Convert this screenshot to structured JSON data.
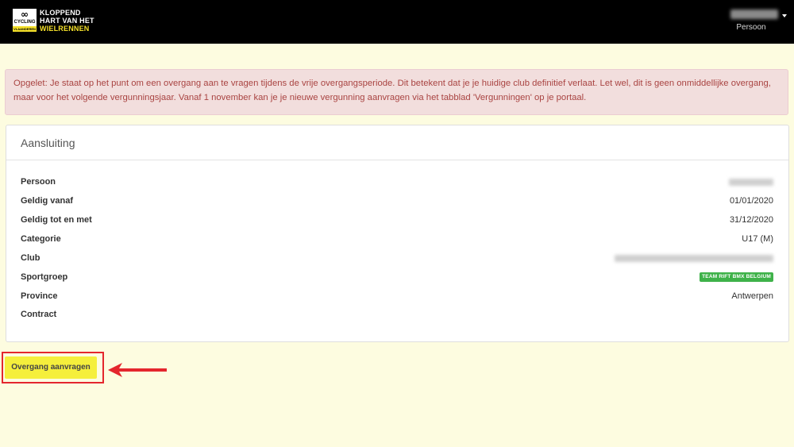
{
  "header": {
    "logo": {
      "icon": "infinity-icon",
      "mark": "∞",
      "cycling": "CYCLING",
      "vlaanderen": "VLAANDEREN",
      "line1": "KLOPPEND",
      "line2": "HART VAN HET",
      "line3": "WIELRENNEN"
    },
    "user": {
      "role_label": "Persoon"
    }
  },
  "alert": {
    "text": "Opgelet: Je staat op het punt om een overgang aan te vragen tijdens de vrije overgangsperiode. Dit betekent dat je je huidige club definitief verlaat. Let wel, dit is geen onmiddellijke overgang, maar voor het volgende vergunningsjaar. Vanaf 1 november kan je je nieuwe vergunning aanvragen via het tabblad 'Vergunningen' op je portaal."
  },
  "panel": {
    "title": "Aansluiting",
    "rows": [
      {
        "label": "Persoon",
        "value": ""
      },
      {
        "label": "Geldig vanaf",
        "value": "01/01/2020"
      },
      {
        "label": "Geldig tot en met",
        "value": "31/12/2020"
      },
      {
        "label": "Categorie",
        "value": "U17 (M)"
      },
      {
        "label": "Club",
        "value": ""
      },
      {
        "label": "Sportgroep",
        "value": "TEAM RIFT BMX BELGIUM"
      },
      {
        "label": "Province",
        "value": "Antwerpen"
      },
      {
        "label": "Contract",
        "value": ""
      }
    ]
  },
  "action": {
    "button_label": "Overgang aanvragen"
  },
  "colors": {
    "topbar": "#000000",
    "background": "#fdfce0",
    "alert_bg": "#f2dedd",
    "alert_text": "#a94442",
    "button_bg": "#f5ef3c",
    "tag_bg": "#3fb24a",
    "highlight": "#e4262d"
  }
}
